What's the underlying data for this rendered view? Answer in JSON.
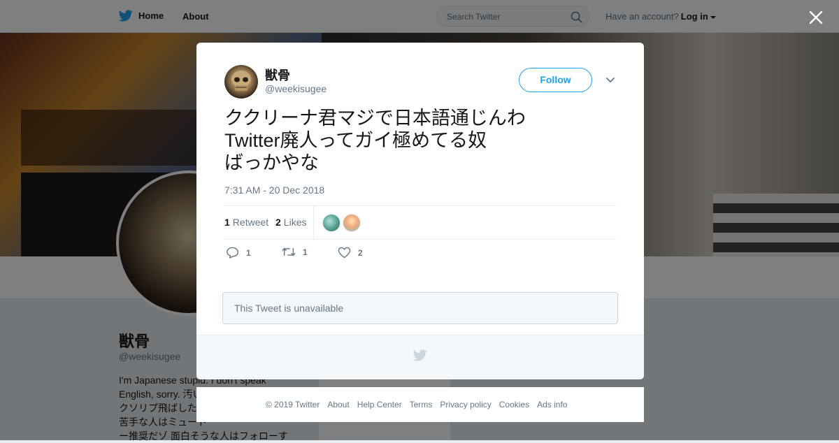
{
  "topbar": {
    "home_label": "Home",
    "about_label": "About",
    "search_placeholder": "Search Twitter",
    "account_prompt": "Have an account?",
    "login_label": "Log in"
  },
  "profile": {
    "name": "獣骨",
    "handle": "@weekisugee",
    "bio_lines": [
      "I'm Japanese stupid. I don't speak",
      "English, sorry. 汚い",
      "クソリプ飛ばした",
      "苦手な人はミュート",
      "ー推奨だゾ 面白そうな人はフォローす"
    ]
  },
  "tweet": {
    "author_name": "獣骨",
    "author_handle": "@weekisugee",
    "follow_label": "Follow",
    "text_lines": [
      "ククリーナ君マジで日本語通じんわ",
      "Twitter廃人ってガイ極めてる奴",
      "ばっかやな"
    ],
    "timestamp": "7:31 AM - 20 Dec 2018",
    "retweet_count": "1",
    "retweet_label": "Retweet",
    "like_count": "2",
    "like_label": "Likes",
    "actions": {
      "reply_count": "1",
      "retweet_count": "1",
      "like_count": "2"
    },
    "quoted_unavailable": "This Tweet is unavailable"
  },
  "footer": {
    "copyright": "© 2019 Twitter",
    "links": [
      "About",
      "Help Center",
      "Terms",
      "Privacy policy",
      "Cookies",
      "Ads info"
    ]
  },
  "colors": {
    "accent": "#1da1f2",
    "text_primary": "#14171a",
    "text_secondary": "#657786",
    "border": "#e6ecf0"
  },
  "icons": [
    "twitter-bird-icon",
    "search-icon",
    "close-icon",
    "chevron-down-icon",
    "reply-icon",
    "retweet-icon",
    "heart-icon"
  ]
}
